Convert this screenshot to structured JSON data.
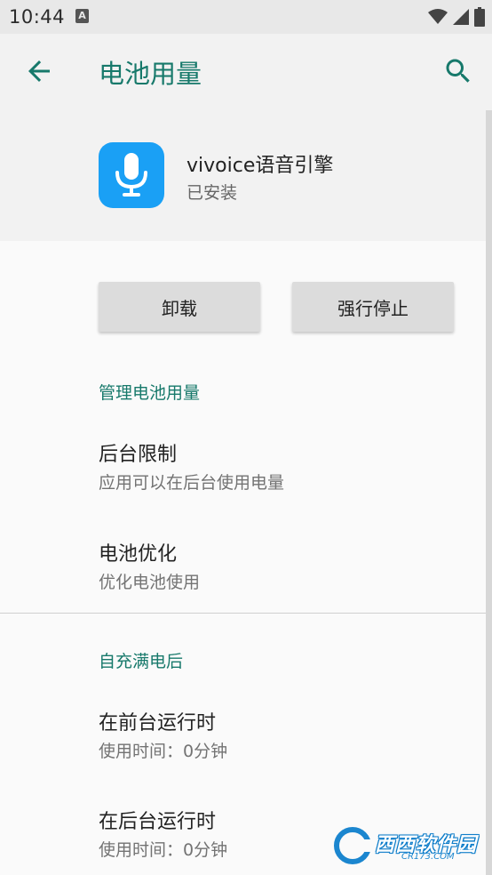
{
  "status_bar": {
    "time": "10:44",
    "notification_glyph": "A",
    "icons": [
      "wifi-icon",
      "signal-icon",
      "battery-icon"
    ]
  },
  "app_bar": {
    "title": "电池用量",
    "back_icon": "arrow-back-icon",
    "search_icon": "search-icon"
  },
  "app_info": {
    "name": "vivoice语音引擎",
    "status": "已安装",
    "icon": "microphone-icon",
    "icon_color": "#1aa0f5"
  },
  "buttons": {
    "uninstall": "卸载",
    "force_stop": "强行停止"
  },
  "sections": [
    {
      "title": "管理电池用量",
      "items": [
        {
          "title": "后台限制",
          "subtitle": "应用可以在后台使用电量"
        },
        {
          "title": "电池优化",
          "subtitle": "优化电池使用"
        }
      ]
    },
    {
      "title": "自充满电后",
      "items": [
        {
          "title": "在前台运行时",
          "subtitle": "使用时间：0分钟"
        },
        {
          "title": "在后台运行时",
          "subtitle": "使用时间：0分钟"
        }
      ]
    }
  ],
  "watermark": {
    "text": "西西软件园",
    "sub": "CR173.COM"
  },
  "colors": {
    "accent": "#17796b",
    "background": "#f2f2f2",
    "content_background": "#fafafa"
  }
}
